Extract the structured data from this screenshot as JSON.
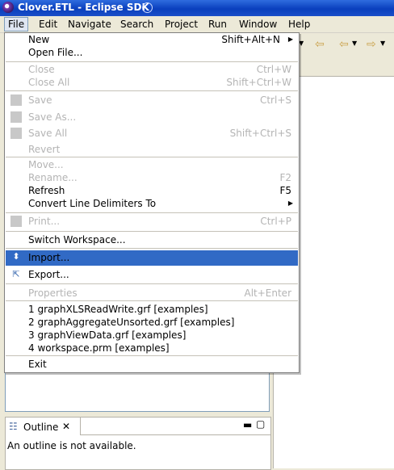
{
  "window": {
    "title": "Clover.ETL - Eclipse SDK"
  },
  "menubar": [
    {
      "label": "File"
    },
    {
      "label": "Edit"
    },
    {
      "label": "Navigate"
    },
    {
      "label": "Search"
    },
    {
      "label": "Project"
    },
    {
      "label": "Run"
    },
    {
      "label": "Window"
    },
    {
      "label": "Help"
    }
  ],
  "file_menu": {
    "new": {
      "label": "New",
      "shortcut": "Shift+Alt+N"
    },
    "open_file": {
      "label": "Open File..."
    },
    "close": {
      "label": "Close",
      "shortcut": "Ctrl+W"
    },
    "close_all": {
      "label": "Close All",
      "shortcut": "Shift+Ctrl+W"
    },
    "save": {
      "label": "Save",
      "shortcut": "Ctrl+S"
    },
    "save_as": {
      "label": "Save As..."
    },
    "save_all": {
      "label": "Save All",
      "shortcut": "Shift+Ctrl+S"
    },
    "revert": {
      "label": "Revert"
    },
    "move": {
      "label": "Move..."
    },
    "rename": {
      "label": "Rename...",
      "shortcut": "F2"
    },
    "refresh": {
      "label": "Refresh",
      "shortcut": "F5"
    },
    "convert": {
      "label": "Convert Line Delimiters To"
    },
    "print": {
      "label": "Print...",
      "shortcut": "Ctrl+P"
    },
    "switch_workspace": {
      "label": "Switch Workspace..."
    },
    "import": {
      "label": "Import..."
    },
    "export": {
      "label": "Export..."
    },
    "properties": {
      "label": "Properties",
      "shortcut": "Alt+Enter"
    },
    "recent": [
      {
        "label": "1 graphXLSReadWrite.grf  [examples]"
      },
      {
        "label": "2 graphAggregateUnsorted.grf  [examples]"
      },
      {
        "label": "3 graphViewData.grf  [examples]"
      },
      {
        "label": "4 workspace.prm  [examples]"
      }
    ],
    "exit": {
      "label": "Exit"
    }
  },
  "outline": {
    "tab_label": "Outline",
    "message": "An outline is not available."
  },
  "colors": {
    "titlebar": "#0a3fbd",
    "highlight": "#316ac5",
    "disabled_text": "#b4b4b4",
    "chrome": "#ece9d8"
  }
}
